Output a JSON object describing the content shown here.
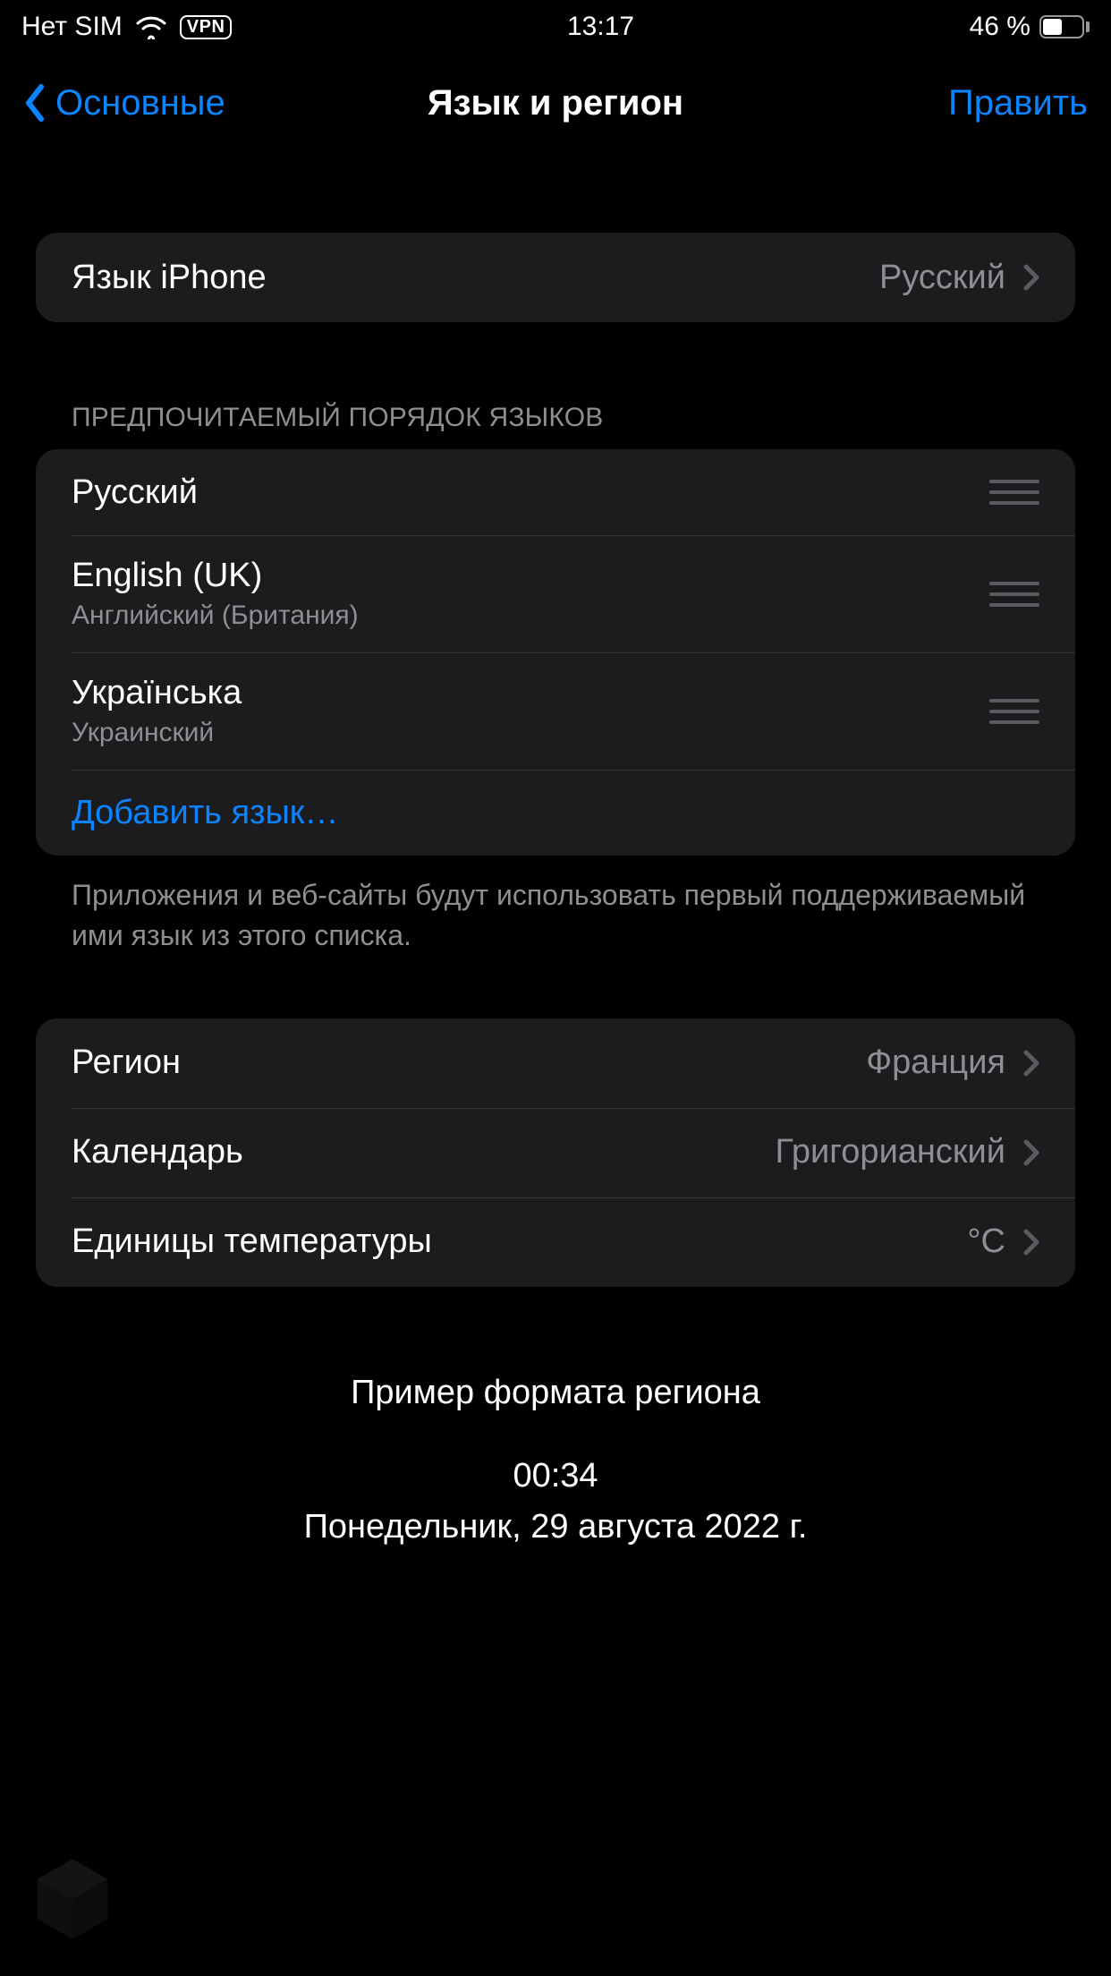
{
  "status": {
    "carrier": "Нет SIM",
    "vpn": "VPN",
    "time": "13:17",
    "battery_pct": "46 %"
  },
  "nav": {
    "back": "Основные",
    "title": "Язык и регион",
    "edit": "Править"
  },
  "iphone_lang": {
    "label": "Язык iPhone",
    "value": "Русский"
  },
  "preferred": {
    "header": "ПРЕДПОЧИТАЕМЫЙ ПОРЯДОК ЯЗЫКОВ",
    "items": [
      {
        "name": "Русский",
        "sub": ""
      },
      {
        "name": "English (UK)",
        "sub": "Английский (Британия)"
      },
      {
        "name": "Українська",
        "sub": "Украинский"
      }
    ],
    "add": "Добавить язык…",
    "footer": "Приложения и веб-сайты будут использовать первый поддерживаемый ими язык из этого списка."
  },
  "region_group": {
    "region": {
      "label": "Регион",
      "value": "Франция"
    },
    "calendar": {
      "label": "Календарь",
      "value": "Григорианский"
    },
    "temperature": {
      "label": "Единицы температуры",
      "value": "°C"
    }
  },
  "example": {
    "title": "Пример формата региона",
    "time": "00:34",
    "date": "Понедельник, 29 августа 2022 г."
  }
}
